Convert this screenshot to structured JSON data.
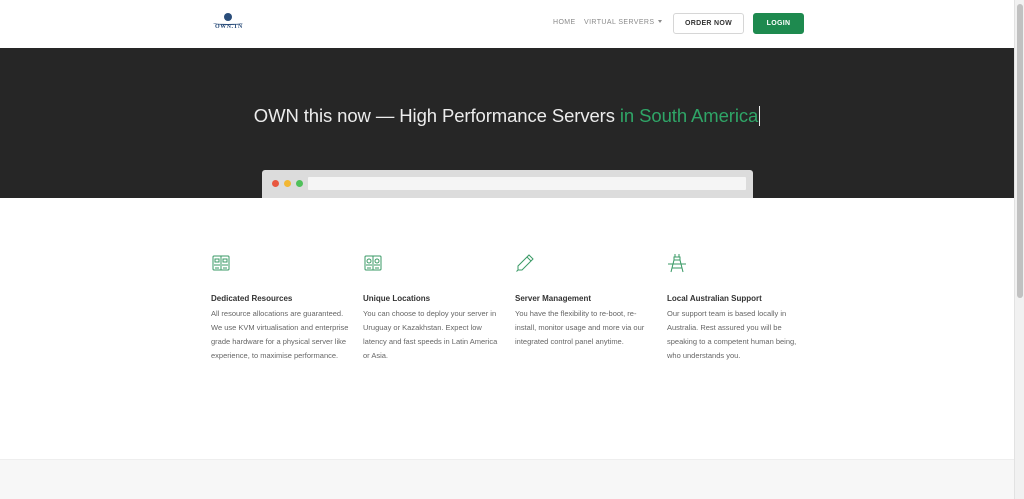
{
  "header": {
    "logo_text": "OWN.TN",
    "nav": {
      "home": "HOME",
      "virtual_servers": "VIRTUAL SERVERS"
    },
    "order_button": "ORDER NOW",
    "login_button": "LOGIN"
  },
  "hero": {
    "title_main": "OWN this now — High Performance Servers",
    "title_highlight": "in South America"
  },
  "features": [
    {
      "icon": "server-rack-icon",
      "title": "Dedicated Resources",
      "text": "All resource allocations are guaranteed. We use KVM virtualisation and enterprise grade hardware for a physical server like experience, to maximise performance."
    },
    {
      "icon": "location-rack-icon",
      "title": "Unique Locations",
      "text": "You can choose to deploy your server in Uruguay or Kazakhstan.  Expect low latency and fast speeds in Latin America or Asia."
    },
    {
      "icon": "pencil-icon",
      "title": "Server Management",
      "text": "You have the flexibility to re-boot, re-install, monitor usage and more via our integrated control panel anytime."
    },
    {
      "icon": "support-tower-icon",
      "title": "Local Australian Support",
      "text": "Our support team is based locally in Australia. Rest assured you will be speaking to a competent human being, who understands you."
    }
  ],
  "colors": {
    "accent_green": "#1e8a4f",
    "hero_green": "#2fa567",
    "hero_bg": "#262626",
    "icon_green": "#3a9a66"
  }
}
